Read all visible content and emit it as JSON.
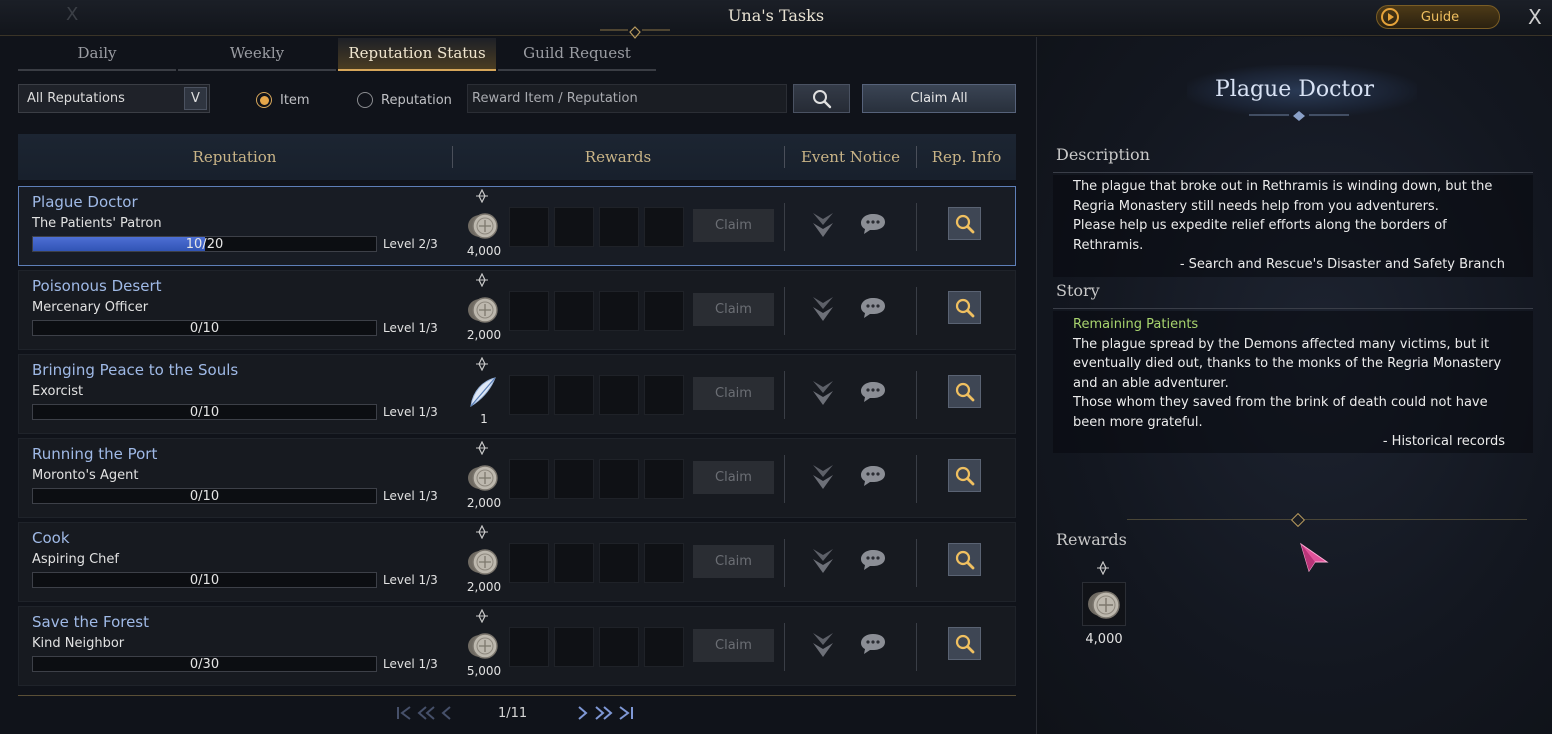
{
  "window": {
    "title": "Una's Tasks",
    "guide_label": "Guide",
    "close_glyph": "X",
    "ghost_close_glyph": "X"
  },
  "tabs": [
    {
      "label": "Daily",
      "active": false
    },
    {
      "label": "Weekly",
      "active": false
    },
    {
      "label": "Reputation Status",
      "active": true
    },
    {
      "label": "Guild Request",
      "active": false
    }
  ],
  "filter": {
    "select_value": "All Reputations",
    "select_arrow": "V",
    "radio_item_label": "Item",
    "radio_reputation_label": "Reputation",
    "radio_selected": "item",
    "search_placeholder": "Reward Item / Reputation",
    "claim_all_label": "Claim All"
  },
  "table": {
    "headers": {
      "reputation": "Reputation",
      "rewards": "Rewards",
      "event_notice": "Event Notice",
      "rep_info": "Rep. Info"
    },
    "claim_label": "Claim",
    "rows": [
      {
        "name": "Plague Doctor",
        "title": "The Patients' Patron",
        "progress_text": "10/20",
        "progress": 0.5,
        "level": "Level 2/3",
        "reward_icon": "silver-coin-icon",
        "reward_qty": "4,000",
        "selected": true
      },
      {
        "name": "Poisonous Desert",
        "title": "Mercenary Officer",
        "progress_text": "0/10",
        "progress": 0,
        "level": "Level 1/3",
        "reward_icon": "silver-coin-icon",
        "reward_qty": "2,000",
        "selected": false
      },
      {
        "name": "Bringing Peace to the Souls",
        "title": "Exorcist",
        "progress_text": "0/10",
        "progress": 0,
        "level": "Level 1/3",
        "reward_icon": "feather-icon",
        "reward_qty": "1",
        "selected": false
      },
      {
        "name": "Running the Port",
        "title": "Moronto's Agent",
        "progress_text": "0/10",
        "progress": 0,
        "level": "Level 1/3",
        "reward_icon": "silver-coin-icon",
        "reward_qty": "2,000",
        "selected": false
      },
      {
        "name": "Cook",
        "title": "Aspiring Chef",
        "progress_text": "0/10",
        "progress": 0,
        "level": "Level 1/3",
        "reward_icon": "silver-coin-icon",
        "reward_qty": "2,000",
        "selected": false
      },
      {
        "name": "Save the Forest",
        "title": "Kind Neighbor",
        "progress_text": "0/30",
        "progress": 0,
        "level": "Level 1/3",
        "reward_icon": "silver-coin-icon",
        "reward_qty": "5,000",
        "selected": false
      }
    ]
  },
  "pagination": {
    "first_glyph": "K",
    "prev_fast_glyph": "«",
    "prev_glyph": "‹",
    "page_text": "1/11",
    "next_glyph": "›",
    "next_fast_glyph": "»",
    "last_glyph": "›I"
  },
  "detail": {
    "title": "Plague Doctor",
    "description_label": "Description",
    "description_lines": [
      "The plague that broke out in Rethramis is winding down, but the",
      "Regria Monastery still needs help from you adventurers.",
      "Please help us expedite relief efforts along the borders of",
      "Rethramis."
    ],
    "description_signature": "- Search and Rescue's Disaster and Safety Branch",
    "story_label": "Story",
    "story_heading": "Remaining Patients",
    "story_lines": [
      "The plague spread by the Demons affected many victims, but it",
      "eventually died out, thanks to the monks of the Regria Monastery",
      "and an able adventurer.",
      "Those whom they saved from the brink of death could not have",
      "been more grateful."
    ],
    "story_signature": "- Historical records",
    "rewards_label": "Rewards",
    "reward_icon": "silver-coin-icon",
    "reward_qty": "4,000"
  },
  "colors": {
    "accent_gold": "#d6a65a",
    "name_blue": "#9fb9e6",
    "progress_blue": "#3f62c8",
    "story_heading_green": "#a8d46e"
  }
}
